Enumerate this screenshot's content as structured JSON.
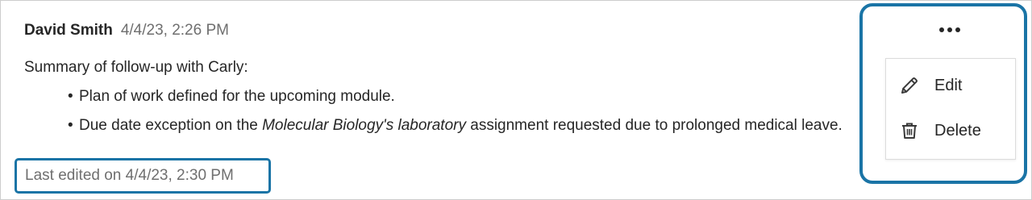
{
  "note": {
    "author": "David Smith",
    "timestamp": "4/4/23, 2:26 PM",
    "summary": "Summary of follow-up with Carly:",
    "bullets": [
      {
        "text": "Plan of work defined for the upcoming module."
      },
      {
        "prefix": "Due date exception on the ",
        "emphasis": "Molecular Biology's laboratory",
        "suffix": " assignment requested due to prolonged medical leave."
      }
    ],
    "last_edited": "Last edited on 4/4/23, 2:30 PM"
  },
  "menu": {
    "more_icon": "ellipsis-horizontal-icon",
    "items": [
      {
        "label": "Edit",
        "icon": "pencil-icon"
      },
      {
        "label": "Delete",
        "icon": "trash-icon"
      }
    ]
  },
  "colors": {
    "highlight": "#1a74a6",
    "text": "#262626",
    "muted": "#6f6f6f"
  }
}
